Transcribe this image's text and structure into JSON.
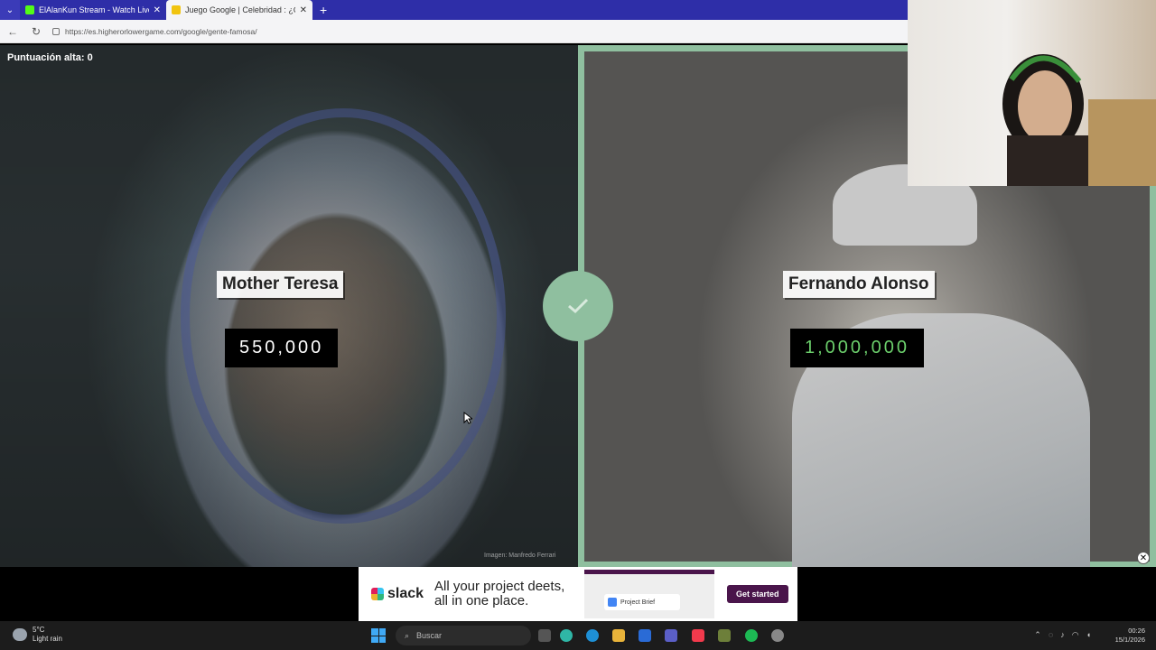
{
  "browser": {
    "tabs": [
      {
        "title": "ElAlanKun Stream - Watch Live on",
        "favicon_color": "#53fc18",
        "active": false
      },
      {
        "title": "Juego Google | Celebridad : ¿Quién",
        "favicon_color": "#f1c40f",
        "active": true
      }
    ],
    "url": "https://es.higherorlowergame.com/google/gente-famosa/"
  },
  "game": {
    "high_score_label": "Puntuación alta: 0",
    "left": {
      "name": "Mother Teresa",
      "value": "550,000"
    },
    "right": {
      "name": "Fernando Alonso",
      "value": "1,000,000"
    },
    "image_credit": "Imagen: Manfredo Ferrari",
    "accent_color": "#8fbf9f",
    "result_icon": "check-icon"
  },
  "ad": {
    "brand": "slack",
    "headline": "All your project deets, all in one place.",
    "doc_title": "Project Brief",
    "cta": "Get started"
  },
  "taskbar": {
    "weather_temp": "5°C",
    "weather_desc": "Light rain",
    "search_placeholder": "Buscar",
    "time": "00:26",
    "date": "15/1/2026"
  }
}
